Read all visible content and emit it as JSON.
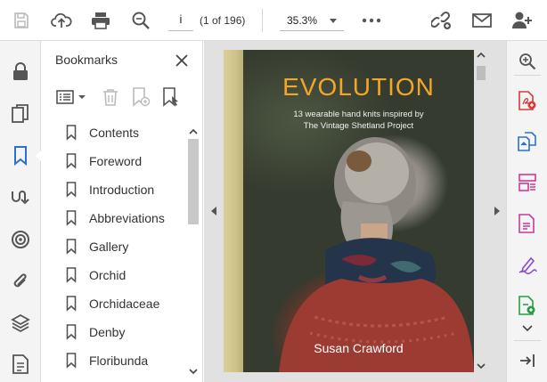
{
  "toolbar": {
    "page_current": "i",
    "page_count": "(1 of 196)",
    "zoom": "35.3%",
    "icons": [
      "save-icon",
      "cloud-upload-icon",
      "print-icon",
      "zoom-search-icon",
      "more-icon",
      "share-link-icon",
      "email-icon",
      "add-user-icon"
    ]
  },
  "left_rail": {
    "icons": [
      "lock-icon",
      "pages-icon",
      "bookmark-icon",
      "signatures-icon",
      "layers-target-icon",
      "attachment-icon",
      "layers-icon",
      "document-properties-icon"
    ]
  },
  "bookmarks": {
    "title": "Bookmarks",
    "items": [
      "Contents",
      "Foreword",
      "Introduction",
      "Abbreviations",
      "Gallery",
      "Orchid",
      "Orchidaceae",
      "Denby",
      "Floribunda"
    ]
  },
  "document": {
    "cover_title": "EVOLUTION",
    "cover_subtitle_line1": "13 wearable hand knits inspired by",
    "cover_subtitle_line2": "The Vintage Shetland Project",
    "cover_author": "Susan Crawford"
  },
  "colors": {
    "accent_blue": "#2c6fce",
    "cover_title": "#f4a62a",
    "tool_red": "#d93a3a",
    "tool_pink": "#d2388f",
    "tool_purple": "#8a4bd6",
    "tool_green": "#2a9a4a"
  }
}
